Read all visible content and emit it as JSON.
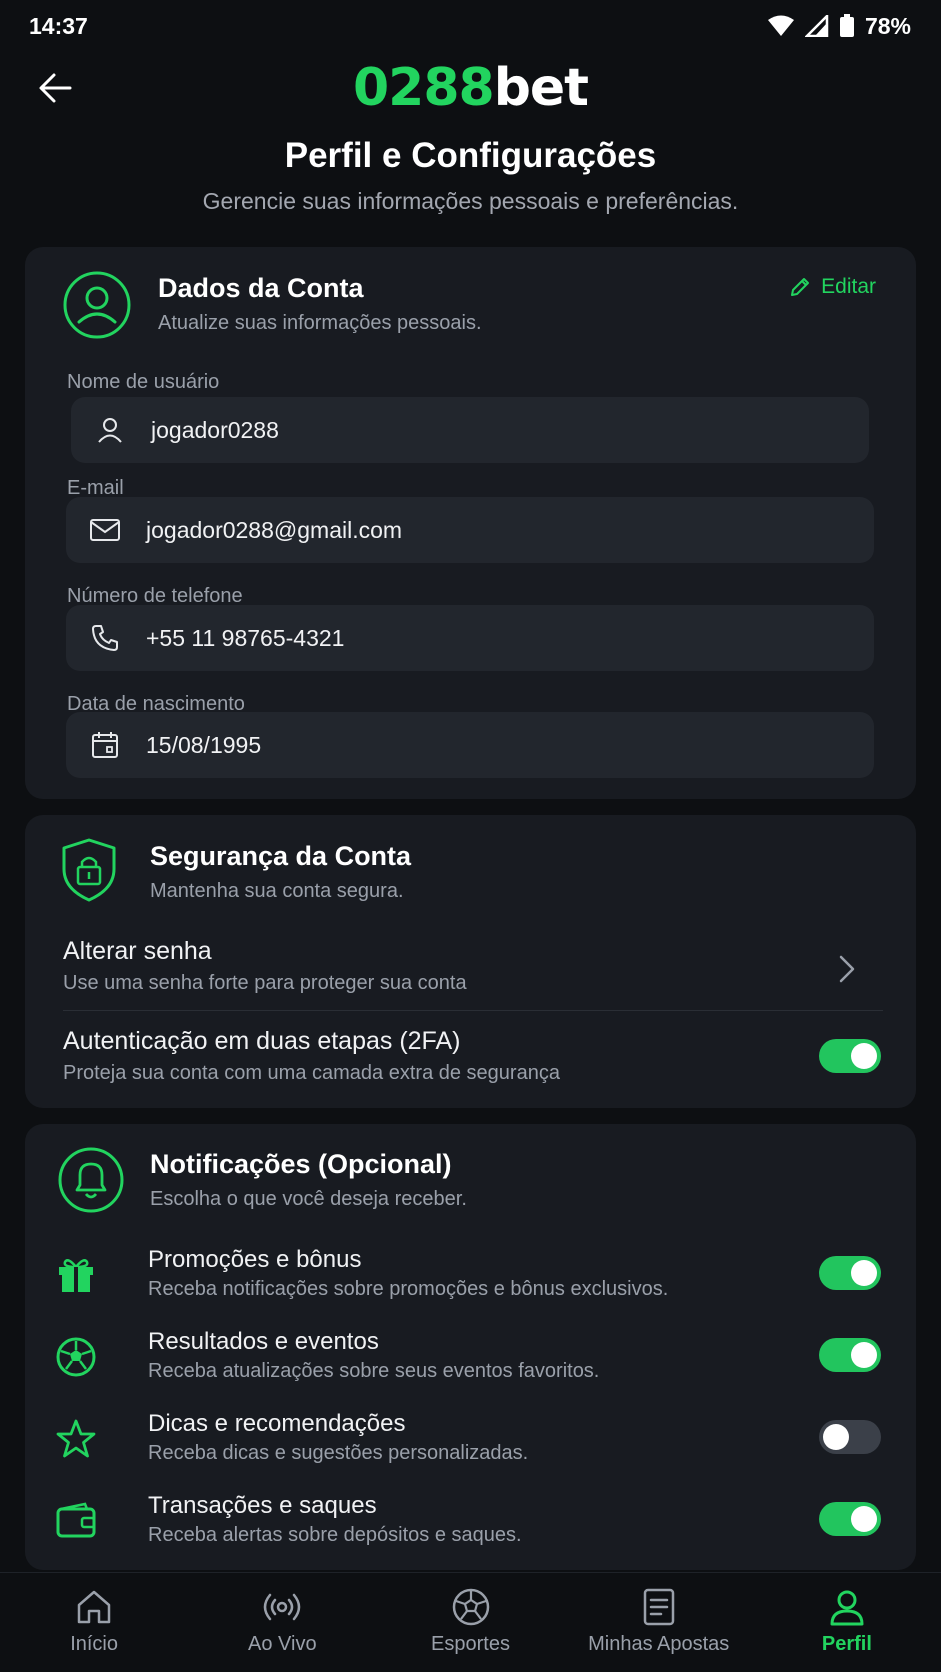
{
  "status": {
    "time": "14:37",
    "battery": "78%"
  },
  "header": {
    "logo_num": "0288",
    "logo_bet": "bet",
    "title": "Perfil e Configurações",
    "subtitle": "Gerencie suas informações pessoais e preferências."
  },
  "account": {
    "title": "Dados da Conta",
    "subtitle": "Atualize suas informações pessoais.",
    "edit_label": "Editar",
    "fields": [
      {
        "label": "Nome de usuário",
        "value": "jogador0288",
        "icon": "user-icon"
      },
      {
        "label": "E-mail",
        "value": "jogador0288@gmail.com",
        "icon": "mail-icon"
      },
      {
        "label": "Número de telefone",
        "value": "+55 11 98765-4321",
        "icon": "phone-icon"
      },
      {
        "label": "Data de nascimento",
        "value": "15/08/1995",
        "icon": "calendar-icon"
      }
    ]
  },
  "security": {
    "title": "Segurança da Conta",
    "subtitle": "Mantenha sua conta segura.",
    "change_password": {
      "title": "Alterar senha",
      "subtitle": "Use uma senha forte para proteger sua conta"
    },
    "two_factor": {
      "title": "Autenticação em duas etapas (2FA)",
      "subtitle": "Proteja sua conta com uma camada extra de segurança",
      "enabled": true
    }
  },
  "notifications": {
    "title": "Notificações (Opcional)",
    "subtitle": "Escolha o que você deseja receber.",
    "items": [
      {
        "title": "Promoções e bônus",
        "subtitle": "Receba notificações sobre promoções e bônus exclusivos.",
        "icon": "gift-icon",
        "enabled": true
      },
      {
        "title": "Resultados e eventos",
        "subtitle": "Receba atualizações sobre seus eventos favoritos.",
        "icon": "soccer-ball-icon",
        "enabled": true
      },
      {
        "title": "Dicas e recomendações",
        "subtitle": "Receba dicas e sugestões personalizadas.",
        "icon": "star-icon",
        "enabled": false
      },
      {
        "title": "Transações e saques",
        "subtitle": "Receba alertas sobre depósitos e saques.",
        "icon": "wallet-icon",
        "enabled": true
      }
    ]
  },
  "nav": {
    "items": [
      {
        "label": "Início",
        "icon": "home-icon"
      },
      {
        "label": "Ao Vivo",
        "icon": "live-icon"
      },
      {
        "label": "Esportes",
        "icon": "soccer-ball-icon"
      },
      {
        "label": "Minhas Apostas",
        "icon": "bets-icon"
      },
      {
        "label": "Perfil",
        "icon": "profile-icon",
        "active": true
      }
    ]
  },
  "colors": {
    "accent": "#22d45f",
    "background": "#0d0f12",
    "card": "#181b21",
    "field": "#22262d"
  }
}
